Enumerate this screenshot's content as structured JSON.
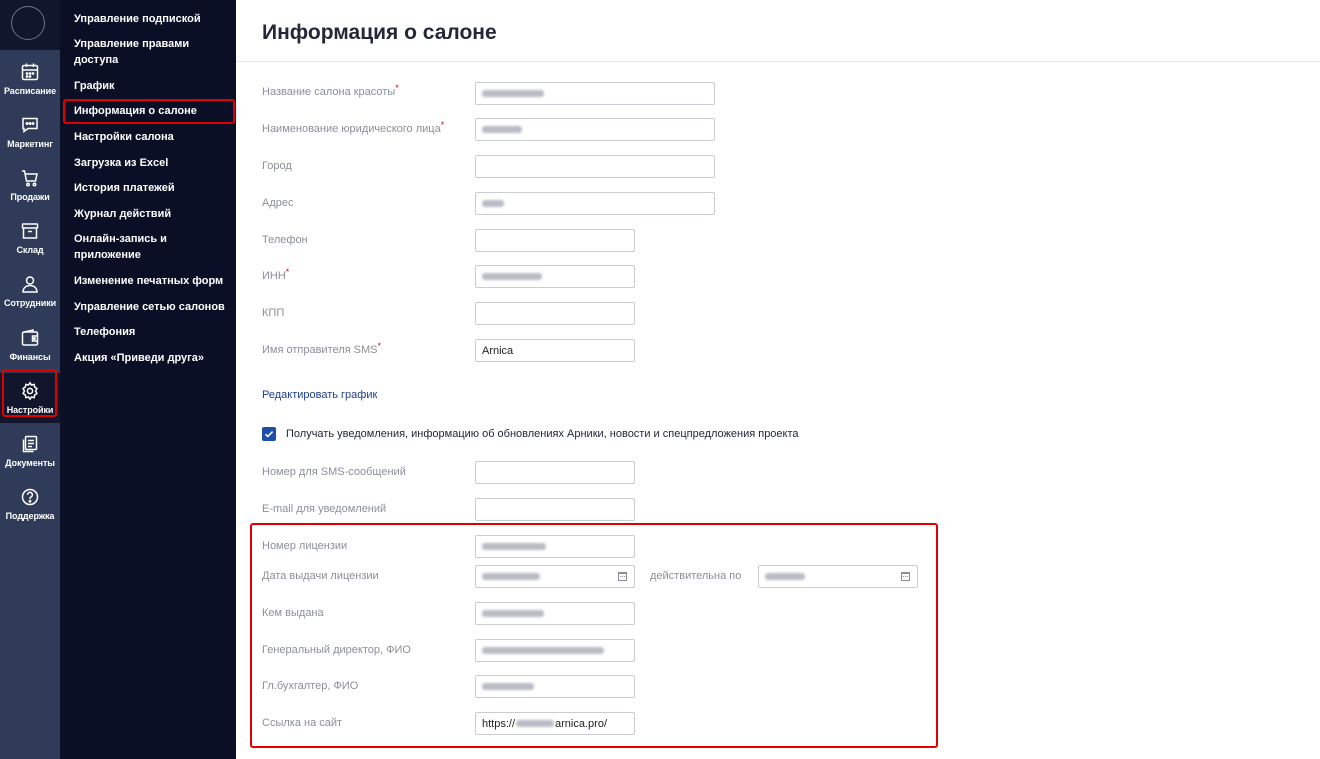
{
  "rail": {
    "items": [
      {
        "label": "Расписание",
        "icon": "calendar-icon"
      },
      {
        "label": "Маркетинг",
        "icon": "chat-icon"
      },
      {
        "label": "Продажи",
        "icon": "cart-icon"
      },
      {
        "label": "Склад",
        "icon": "archive-icon"
      },
      {
        "label": "Сотрудники",
        "icon": "user-icon"
      },
      {
        "label": "Финансы",
        "icon": "wallet-icon"
      },
      {
        "label": "Настройки",
        "icon": "gear-icon"
      },
      {
        "label": "Документы",
        "icon": "documents-icon"
      },
      {
        "label": "Поддержка",
        "icon": "help-icon"
      }
    ],
    "active": "Настройки"
  },
  "submenu": {
    "items": [
      "Управление подпиской",
      "Управление правами доступа",
      "График",
      "Информация о салоне",
      "Настройки салона",
      "Загрузка из Excel",
      "История платежей",
      "Журнал действий",
      "Онлайн-запись и приложение",
      "Изменение печатных форм",
      "Управление сетью салонов",
      "Телефония",
      "Акция «Приведи друга»"
    ],
    "active": "Информация о салоне"
  },
  "page": {
    "title": "Информация о салоне"
  },
  "form": {
    "salon_name": {
      "label": "Название салона красоты",
      "required": "*"
    },
    "legal_name": {
      "label": "Наименование юридического лица",
      "required": "*"
    },
    "city": {
      "label": "Город"
    },
    "address": {
      "label": "Адрес"
    },
    "phone": {
      "label": "Телефон"
    },
    "inn": {
      "label": "ИНН",
      "required": "*"
    },
    "kpp": {
      "label": "КПП"
    },
    "sms_sender": {
      "label": "Имя отправителя SMS",
      "required": "*",
      "value": "Arnica"
    },
    "edit_schedule_link": "Редактировать график",
    "notify_checkbox": {
      "label": "Получать уведомления, информацию об обновлениях Арники, новости и спецпредложения проекта",
      "checked": true
    },
    "sms_number": {
      "label": "Номер для SMS-сообщений"
    },
    "notify_email": {
      "label": "E-mail для уведомлений"
    },
    "license_number": {
      "label": "Номер лицензии"
    },
    "license_date": {
      "label": "Дата выдачи лицензии"
    },
    "license_valid_until": {
      "label": "действительна по"
    },
    "issued_by": {
      "label": "Кем выдана"
    },
    "ceo": {
      "label": "Генеральный директор, ФИО"
    },
    "accountant": {
      "label": "Гл.бухгалтер, ФИО"
    },
    "website": {
      "label": "Ссылка на сайт",
      "prefix": "https://",
      "suffix": "arnica.pro/"
    }
  },
  "colors": {
    "rail_bg": "#2f3b58",
    "submenu_bg": "#0b0f26",
    "highlight": "#e00000",
    "link": "#1d3f8f",
    "checkbox": "#1d4fa8"
  }
}
